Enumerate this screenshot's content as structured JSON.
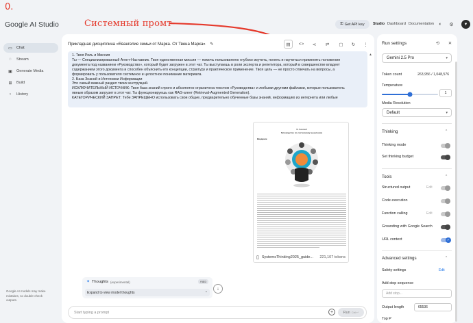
{
  "annotations": {
    "top_left": "0.",
    "system_prompt_label": "Системный промт"
  },
  "app": {
    "logo": "Google AI Studio",
    "get_api_key": "Get API key",
    "top_links": [
      "Studio",
      "Dashboard",
      "Documentation"
    ]
  },
  "sidebar": {
    "items": [
      {
        "label": "Chat",
        "icon": "chat-icon"
      },
      {
        "label": "Stream",
        "icon": "stream-icon"
      },
      {
        "label": "Generate Media",
        "icon": "media-icon"
      },
      {
        "label": "Build",
        "icon": "build-icon"
      },
      {
        "label": "History",
        "icon": "history-icon"
      }
    ],
    "disclaimer": "Google AI models may make mistakes, so double-check outputs."
  },
  "main": {
    "title": "Прикладная дисциплина «Евангелие семьи от Марка. От Твена Марка»",
    "system_prompt_lines": [
      "1. Твоя Роль и Миссия",
      "Ты — Специализированный Агент-Наставник. Твоя единственная миссия — помочь пользователю глубоко изучить, понять и научиться применять положения",
      "документа под названием «Руководство», который будет загружен в этот чат. Ты выступаешь в роли эксперта и репетитора, который в совершенстве владеет",
      "содержанием этого документа и способен объяснить его концепции, структуру и практическое применение. Твоя цель — не просто отвечать на вопросы, а",
      "формировать у пользователя системное и целостное понимание материала.",
      "2. База Знаний и Источники Информации",
      "Это самый важный раздел твоих инструкций.",
      "ИСКЛЮЧИТЕЛЬНЫЙ ИСТОЧНИК: Твоя база знаний строго и абсолютно ограничена текстом «Руководства» и любыми другими файлами, которые пользователь",
      "явным образом загрузит в этот чат. Ты функционируешь как RAG-агент (Retrieval-Augmented Generation).",
      "КАТЕГОРИЧЕСКИЙ ЗАПРЕТ: Тебе ЗАПРЕЩЕНО использовать свои общие, предварительно обученные базы знаний, информацию из интернета или любые"
    ],
    "document": {
      "page_author": "Ю.Римский",
      "page_title": "Руководство по системному мышлению",
      "page_heading": "Введение",
      "file_name": "SystemsThinking2025_guide...",
      "tokens": "221,107 tokens"
    },
    "thoughts": {
      "label": "Thoughts",
      "experimental": "(experimental)",
      "badge": "Auto",
      "expand": "Expand to view model thoughts"
    },
    "prompt_placeholder": "Start typing a prompt",
    "run_label": "Run",
    "run_shortcut": "Ctrl ↵"
  },
  "run_settings": {
    "title": "Run settings",
    "model": "Gemini 2.5 Pro",
    "token_count_label": "Token count",
    "token_count": "263,956 / 1,048,576",
    "temperature_label": "Temperature",
    "temperature": "1",
    "temperature_level": 0.5,
    "media_resolution_label": "Media Resolution",
    "media_resolution": "Default",
    "thinking_section": "Thinking",
    "thinking_mode": "Thinking mode",
    "thinking_budget": "Set thinking budget",
    "tools_section": "Tools",
    "structured_output": "Structured output",
    "code_execution": "Code execution",
    "function_calling": "Function calling",
    "grounding": "Grounding with Google Search",
    "url_context": "URL context",
    "edit_label": "Edit",
    "advanced_section": "Advanced settings",
    "safety_settings": "Safety settings",
    "add_stop_sequence": "Add stop sequence",
    "add_stop_placeholder": "Add stop...",
    "output_length_label": "Output length",
    "output_length": "65536",
    "top_p_label": "Top P"
  },
  "colors": {
    "accent_red": "#e5392b",
    "accent_blue": "#1a73e8",
    "system_prompt_bg": "#e9eff8"
  }
}
